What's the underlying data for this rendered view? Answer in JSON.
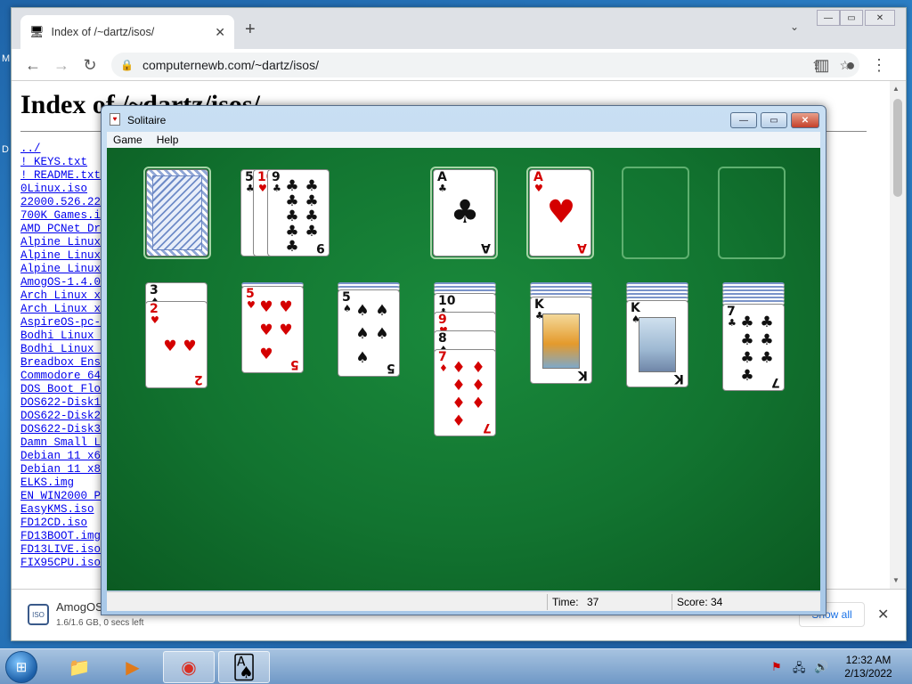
{
  "desktop": {
    "glyph_m": "M",
    "glyph_d": "D"
  },
  "chrome": {
    "tab_title": "Index of /~dartz/isos/",
    "tab_close": "✕",
    "new_tab": "+",
    "tab_menu": "⌄",
    "url": "computernewb.com/~dartz/isos/",
    "window_controls": [
      "—",
      "▭",
      "✕"
    ],
    "page": {
      "title": "Index of /~dartz/isos/",
      "files": [
        "../",
        "! KEYS.txt",
        "! README.txt",
        "0Linux.iso",
        "22000.526.220",
        "700K Games.iso",
        "AMD PCNet Dri",
        "Alpine Linux",
        "Alpine Linux",
        "Alpine Linux",
        "AmogOS-1.4.0-",
        "Arch Linux x6",
        "Arch Linux x8",
        "AspireOS-pc-i",
        "Bodhi Linux x",
        "Bodhi Linux x",
        "Breadbox Ense",
        "Commodore 64",
        "DOS Boot Flop",
        "DOS622-Disk1.",
        "DOS622-Disk2.",
        "DOS622-Disk3.",
        "Damn Small Li",
        "Debian 11 x64",
        "Debian 11 x86",
        "ELKS.img",
        "EN_WIN2000_PR",
        "EasyKMS.iso",
        "FD12CD.iso",
        "FD13BOOT.img",
        "FD13LIVE.iso",
        "FIX95CPU.iso"
      ]
    },
    "download": {
      "icon_label": "ISO",
      "name": "AmogOS",
      "size": "1.6/1.6 GB, 0 secs left",
      "show_all": "Show all",
      "close": "✕"
    }
  },
  "solitaire": {
    "title": "Solitaire",
    "app_icon": "♥",
    "controls": [
      "—",
      "▭",
      "✕"
    ],
    "menu": [
      "Game",
      "Help"
    ],
    "status": {
      "time_label": "Time:",
      "time": "37",
      "score_label": "Score:",
      "score": "34"
    },
    "waste": [
      {
        "rank": "5",
        "suit": "♣",
        "color": "black"
      },
      {
        "rank": "10",
        "suit": "♥",
        "color": "red"
      },
      {
        "rank": "9",
        "suit": "♣",
        "color": "black"
      }
    ],
    "foundations": [
      {
        "rank": "A",
        "suit": "♣",
        "color": "black"
      },
      {
        "rank": "A",
        "suit": "♥",
        "color": "red"
      }
    ],
    "tableau": [
      {
        "hidden": 0,
        "cards": [
          {
            "rank": "3",
            "suit": "♠",
            "color": "black"
          },
          {
            "rank": "2",
            "suit": "♥",
            "color": "red"
          }
        ]
      },
      {
        "hidden": 1,
        "cards": [
          {
            "rank": "5",
            "suit": "♥",
            "color": "red"
          }
        ]
      },
      {
        "hidden": 2,
        "cards": [
          {
            "rank": "5",
            "suit": "♠",
            "color": "black"
          }
        ]
      },
      {
        "hidden": 3,
        "cards": [
          {
            "rank": "10",
            "suit": "♣",
            "color": "black"
          },
          {
            "rank": "9",
            "suit": "♥",
            "color": "red"
          },
          {
            "rank": "8",
            "suit": "♠",
            "color": "black"
          },
          {
            "rank": "7",
            "suit": "♦",
            "color": "red"
          }
        ]
      },
      {
        "hidden": 4,
        "cards": [
          {
            "rank": "K",
            "suit": "♣",
            "color": "black",
            "face": "autumn-tree"
          }
        ]
      },
      {
        "hidden": 5,
        "cards": [
          {
            "rank": "K",
            "suit": "♠",
            "color": "black",
            "face": "winter-tree"
          }
        ]
      },
      {
        "hidden": 6,
        "cards": [
          {
            "rank": "7",
            "suit": "♣",
            "color": "black"
          }
        ]
      }
    ]
  },
  "taskbar": {
    "start_glyph": "⊞",
    "items": [
      {
        "name": "explorer",
        "glyph": "📁"
      },
      {
        "name": "media-player",
        "glyph": "▶"
      },
      {
        "name": "chrome",
        "glyph": "◉"
      },
      {
        "name": "solitaire",
        "glyph": "🂡"
      }
    ],
    "time": "12:32 AM",
    "date": "2/13/2022"
  }
}
